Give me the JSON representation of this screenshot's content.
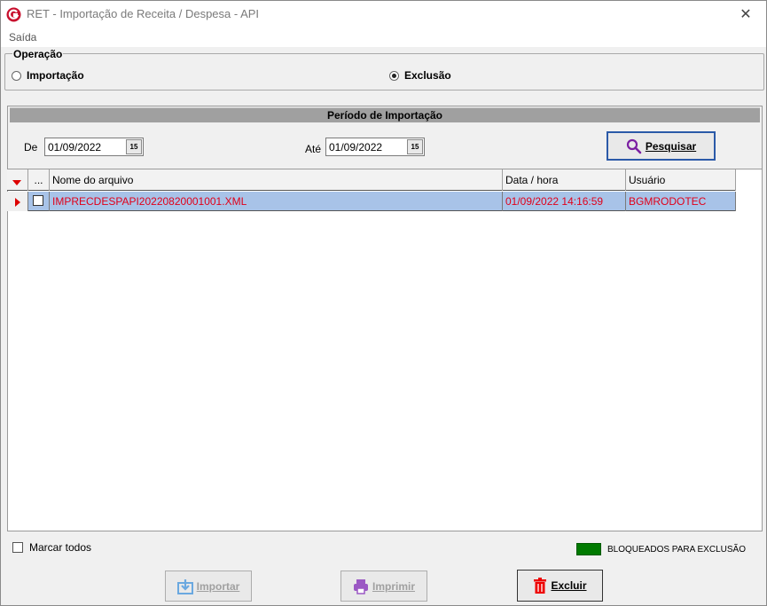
{
  "window": {
    "title": "RET - Importação de Receita / Despesa - API",
    "close": "✕"
  },
  "menu": {
    "items": [
      "Saída"
    ]
  },
  "operation": {
    "title": "Operação",
    "options": [
      {
        "label": "Importação",
        "checked": false
      },
      {
        "label": "Exclusão",
        "checked": true
      }
    ]
  },
  "period": {
    "header": "Período de Importação",
    "from_label": "De",
    "from_value": "01/09/2022",
    "to_label": "Até",
    "to_value": "01/09/2022",
    "calendar_glyph": "15",
    "search_button": "Pesquisar"
  },
  "grid": {
    "columns": [
      "...",
      "Nome do arquivo",
      "Data / hora",
      "Usuário"
    ],
    "rows": [
      {
        "checked": false,
        "file": "IMPRECDESPAPI20220820001001.XML",
        "datetime": "01/09/2022 14:16:59",
        "user": "BGMRODOTEC"
      }
    ]
  },
  "footer": {
    "select_all_label": "Marcar todos",
    "legend_label": "BLOQUEADOS PARA EXCLUSÃO",
    "legend_color": "#007a00",
    "import_button": "Importar",
    "print_button": "Imprimir",
    "delete_button": "Excluir"
  },
  "colors": {
    "row_selected": "#a8c3e8",
    "row_text": "#e0001a",
    "header_bar": "#a0a0a0"
  }
}
